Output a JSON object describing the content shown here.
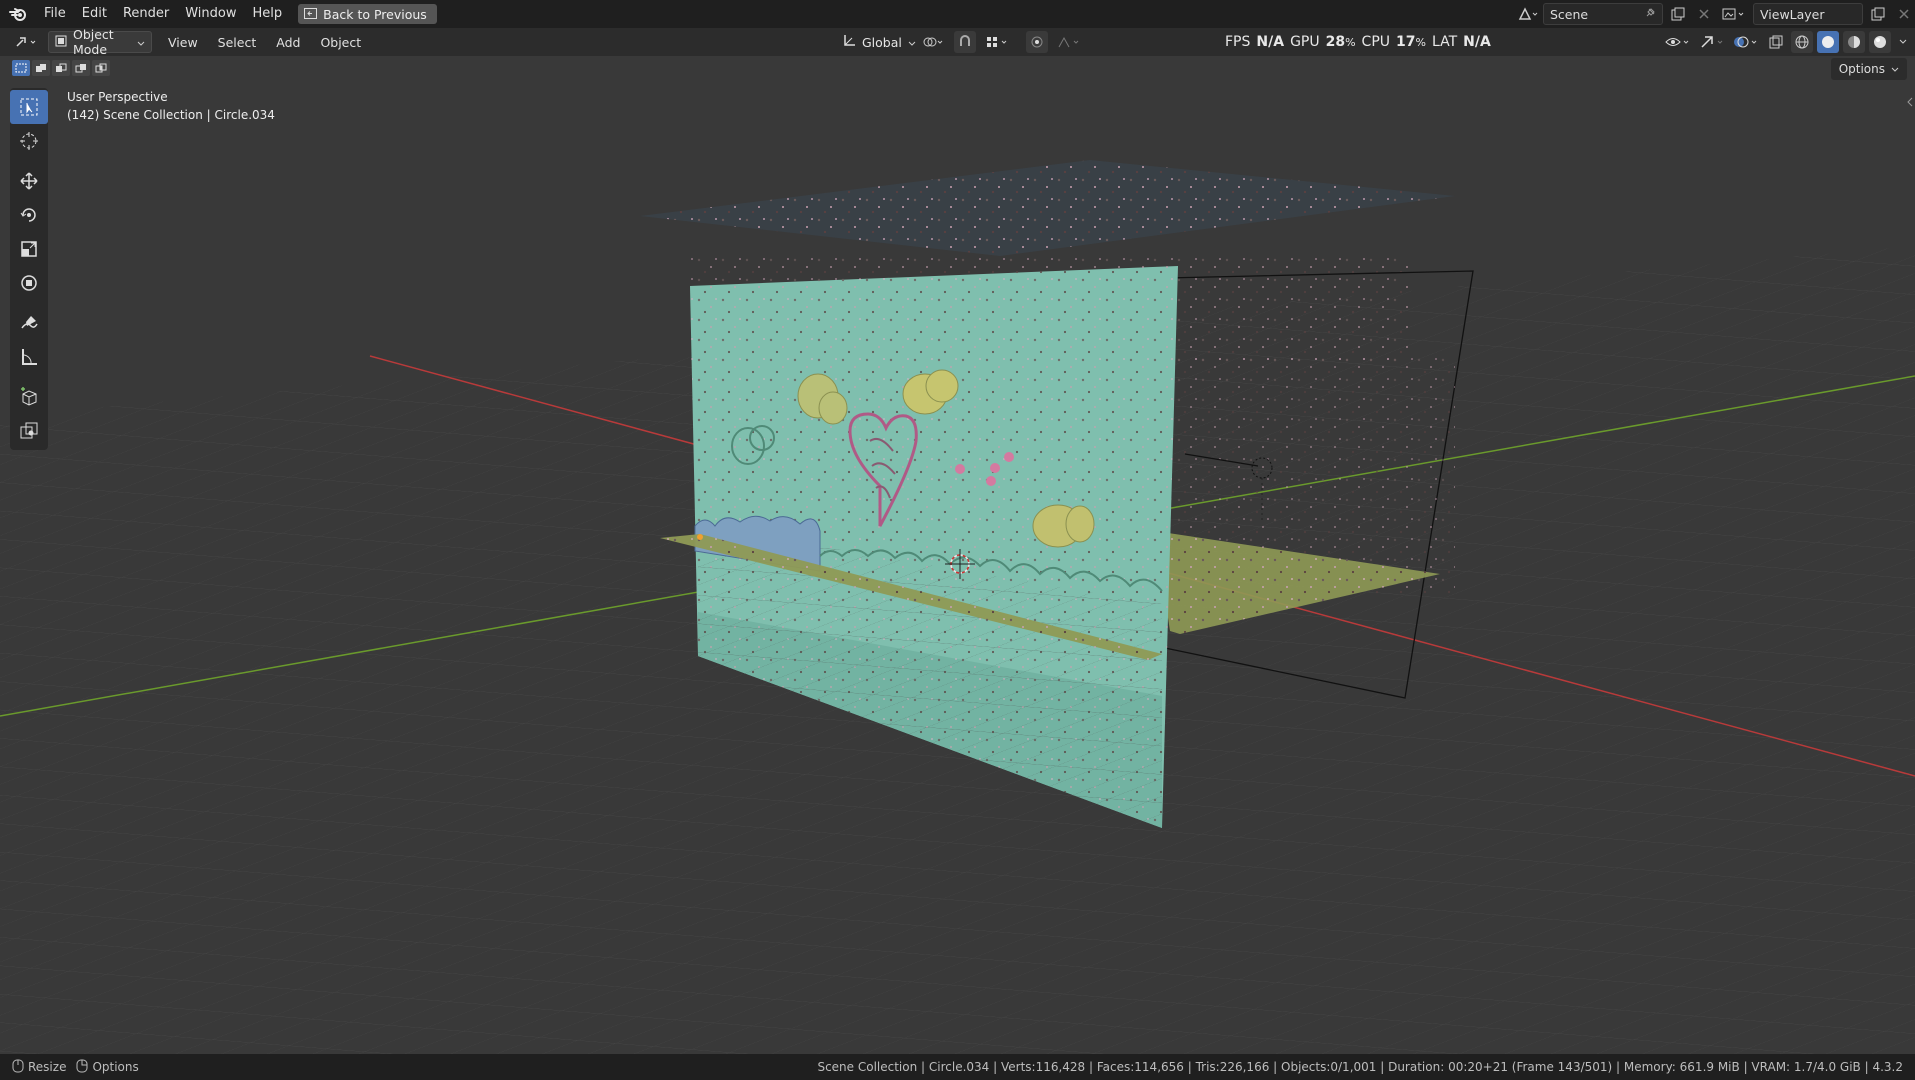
{
  "menubar": {
    "items": [
      "File",
      "Edit",
      "Render",
      "Window",
      "Help"
    ],
    "back_button": "Back to Previous",
    "scene": "Scene",
    "view_layer": "ViewLayer"
  },
  "header": {
    "mode": "Object Mode",
    "menus": [
      "View",
      "Select",
      "Add",
      "Object"
    ],
    "transform_orientation": "Global",
    "stats": {
      "fps_label": "FPS",
      "fps_value": "N/A",
      "gpu_label": "GPU",
      "gpu_value": "28",
      "cpu_label": "CPU",
      "cpu_value": "17",
      "pct": "%",
      "lat_label": "LAT",
      "lat_value": "N/A"
    }
  },
  "viewport": {
    "perspective": "User Perspective",
    "collection": "(142) Scene Collection | Circle.034",
    "options": "Options"
  },
  "statusbar": {
    "left": [
      "Resize",
      "Options"
    ],
    "info": "Scene Collection | Circle.034 | Verts:116,428 | Faces:114,656 | Tris:226,166 | Objects:0/1,001 | Duration: 00:20+21 (Frame 143/501) | Memory: 661.9 MiB | VRAM: 1.7/4.0 GiB | 4.3.2"
  },
  "colors": {
    "accent": "#4772b3",
    "viewport_bg": "#393939",
    "panel": "#2c2c2c",
    "plane": "#7fbfae",
    "ground": "#8f9a55",
    "x_axis": "#b83a3a",
    "y_axis": "#6a9a2c"
  }
}
